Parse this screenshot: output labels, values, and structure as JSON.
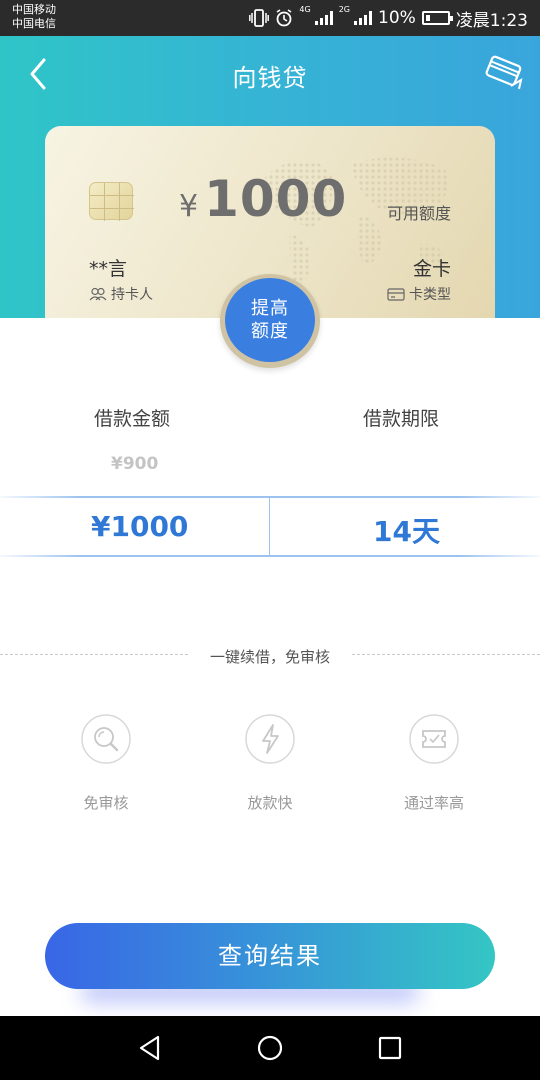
{
  "status_bar": {
    "carrier_1": "中国移动",
    "carrier_2": "中国电信",
    "network_1": "4G",
    "network_2": "2G",
    "battery": "10%",
    "time": "凌晨1:23"
  },
  "header": {
    "title": "向钱贷",
    "background_start": "#2fc5c7",
    "background_end": "#39a5dc"
  },
  "card": {
    "currency_symbol": "¥",
    "amount": "1000",
    "available_label": "可用额度",
    "holder_name": "**言",
    "holder_label": "持卡人",
    "card_tier": "金卡",
    "card_type_label": "卡类型"
  },
  "raise_button": {
    "line1": "提高",
    "line2": "额度",
    "color": "#3a7fe0"
  },
  "loan": {
    "amount_label": "借款金额",
    "term_label": "借款期限",
    "previous_amount": "¥900",
    "selected_amount": "¥1000",
    "selected_term": "14天",
    "accent": "#2f78d6"
  },
  "features": {
    "tagline": "一键续借，免审核",
    "items": [
      {
        "icon": "magnifier-icon",
        "label": "免审核"
      },
      {
        "icon": "lightning-icon",
        "label": "放款快"
      },
      {
        "icon": "ticket-icon",
        "label": "通过率高"
      }
    ]
  },
  "query_button": {
    "label": "查询结果"
  },
  "navigation": {
    "buttons": [
      "back-icon",
      "home-icon",
      "recents-icon"
    ]
  }
}
